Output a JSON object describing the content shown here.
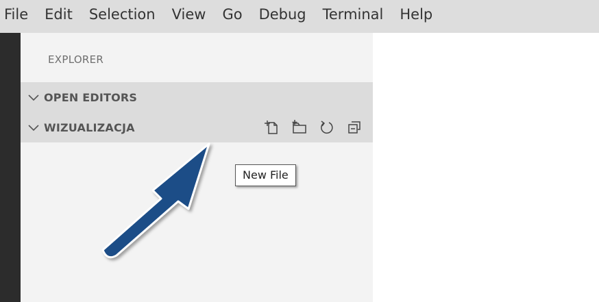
{
  "menubar": {
    "items": [
      "File",
      "Edit",
      "Selection",
      "View",
      "Go",
      "Debug",
      "Terminal",
      "Help"
    ]
  },
  "sidebar": {
    "title": "EXPLORER",
    "sections": [
      {
        "label": "OPEN EDITORS",
        "icon": "chevron-down-icon"
      },
      {
        "label": "WIZUALIZACJA",
        "icon": "chevron-down-icon"
      }
    ],
    "folder_actions": [
      {
        "name": "new-file",
        "icon": "new-file-icon"
      },
      {
        "name": "new-folder",
        "icon": "new-folder-icon"
      },
      {
        "name": "refresh",
        "icon": "refresh-icon"
      },
      {
        "name": "collapse-all",
        "icon": "collapse-all-icon"
      }
    ]
  },
  "tooltip": {
    "text": "New File"
  },
  "colors": {
    "menubar_bg": "#dddddd",
    "activitybar_bg": "#2c2c2c",
    "sidebar_bg": "#f3f3f3",
    "section_header_bg": "#dcdcdc",
    "arrow_fill": "#1f4e87"
  }
}
